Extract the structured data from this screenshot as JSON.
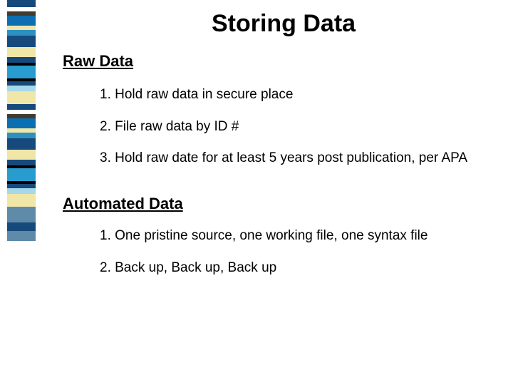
{
  "title": "Storing Data",
  "section1": {
    "heading": "Raw Data",
    "items": {
      "i1": "1.  Hold raw data in secure place",
      "i2": "2.  File raw data by ID #",
      "i3": "3.  Hold raw date for at least 5 years post publication, per APA"
    }
  },
  "section2": {
    "heading": "Automated Data",
    "items": {
      "i1": "1.  One pristine source, one working file, one syntax file",
      "i2": "2.  Back up, Back up, Back up"
    }
  },
  "stripes": [
    {
      "c": "#174a7c",
      "h": 10
    },
    {
      "c": "#ffffff",
      "h": 6
    },
    {
      "c": "#433b2f",
      "h": 6
    },
    {
      "c": "#0b6fb2",
      "h": 14
    },
    {
      "c": "#f0e6a8",
      "h": 6
    },
    {
      "c": "#2d90c1",
      "h": 8
    },
    {
      "c": "#174a7c",
      "h": 16
    },
    {
      "c": "#f0e6a8",
      "h": 14
    },
    {
      "c": "#174a7c",
      "h": 8
    },
    {
      "c": "#000000",
      "h": 4
    },
    {
      "c": "#299ccf",
      "h": 18
    },
    {
      "c": "#000000",
      "h": 4
    },
    {
      "c": "#174a7c",
      "h": 6
    },
    {
      "c": "#a7d8ea",
      "h": 8
    },
    {
      "c": "#f0e6a8",
      "h": 18
    },
    {
      "c": "#174a7c",
      "h": 8
    },
    {
      "c": "#ffffff",
      "h": 6
    },
    {
      "c": "#433b2f",
      "h": 6
    },
    {
      "c": "#0b6fb2",
      "h": 14
    },
    {
      "c": "#f0e6a8",
      "h": 6
    },
    {
      "c": "#2d90c1",
      "h": 8
    },
    {
      "c": "#174a7c",
      "h": 16
    },
    {
      "c": "#f0e6a8",
      "h": 14
    },
    {
      "c": "#174a7c",
      "h": 8
    },
    {
      "c": "#000000",
      "h": 4
    },
    {
      "c": "#299ccf",
      "h": 18
    },
    {
      "c": "#000000",
      "h": 4
    },
    {
      "c": "#174a7c",
      "h": 6
    },
    {
      "c": "#a7d8ea",
      "h": 8
    },
    {
      "c": "#f0e6a8",
      "h": 18
    },
    {
      "c": "#5f8aa8",
      "h": 22
    },
    {
      "c": "#174a7c",
      "h": 12
    },
    {
      "c": "#5f8aa8",
      "h": 14
    }
  ]
}
